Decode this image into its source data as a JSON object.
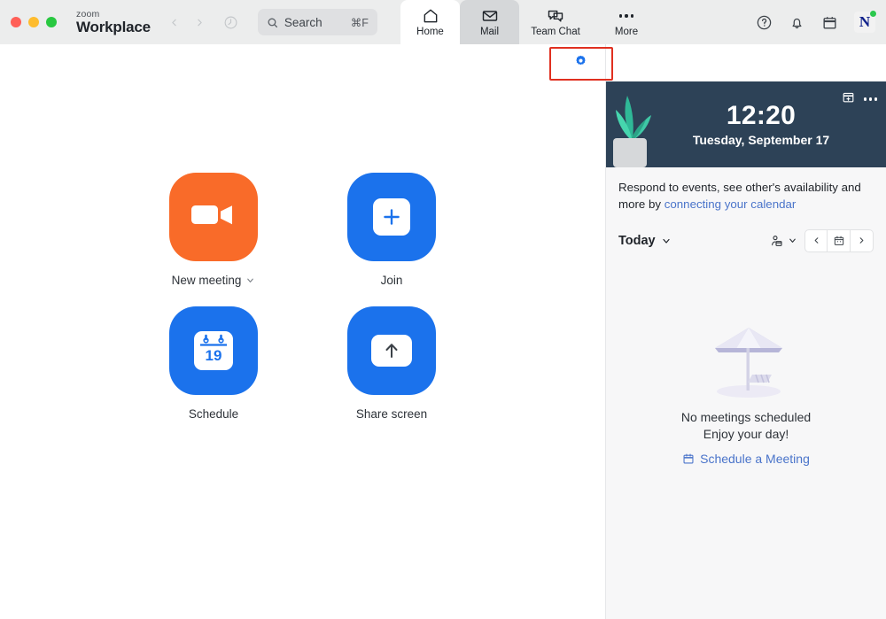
{
  "window": {
    "brand_small": "zoom",
    "brand_large": "Workplace",
    "traffic_lights": [
      "close-red",
      "minimize-yellow",
      "maximize-green"
    ],
    "colors": {
      "titlebar_bg": "#eceded",
      "accent_blue": "#1b72ec",
      "accent_orange": "#f96b29",
      "banner_bg": "#2d4257",
      "link_blue": "#4a74ca",
      "highlight_red": "#e03020",
      "status_green": "#2bc84d"
    }
  },
  "search": {
    "placeholder": "Search",
    "shortcut": "⌘F",
    "icon": "search-icon"
  },
  "nav": {
    "back_icon": "chevron-left-icon",
    "forward_icon": "chevron-right-icon",
    "history_icon": "history-circle-icon",
    "tabs": [
      {
        "label": "Home",
        "icon": "home-icon",
        "state": "active"
      },
      {
        "label": "Mail",
        "icon": "mail-envelope-icon",
        "state": "hover"
      },
      {
        "label": "Team Chat",
        "icon": "chat-bubbles-icon",
        "state": "default"
      },
      {
        "label": "More",
        "icon": "ellipsis-icon",
        "state": "default"
      }
    ],
    "right_icons": [
      {
        "name": "help-question-icon"
      },
      {
        "name": "notification-bell-icon"
      },
      {
        "name": "calendar-icon"
      }
    ],
    "avatar": {
      "initial": "N",
      "status": "online"
    }
  },
  "actions": [
    {
      "label": "New meeting",
      "icon": "video-camera-icon",
      "color": "orange",
      "has_chevron": true
    },
    {
      "label": "Join",
      "icon": "plus-icon",
      "color": "blue",
      "has_chevron": false
    },
    {
      "label": "Schedule",
      "icon": "calendar-19-icon",
      "color": "blue",
      "has_chevron": false,
      "day_number": "19"
    },
    {
      "label": "Share screen",
      "icon": "arrow-up-icon",
      "color": "blue",
      "has_chevron": false
    }
  ],
  "panel": {
    "settings_button": {
      "icon": "gear-icon",
      "highlighted": true
    },
    "banner": {
      "time": "12:20",
      "date": "Tuesday, September 17",
      "icons": [
        "calendar-add-icon",
        "ellipsis-icon"
      ],
      "decoration": "plant-illustration"
    },
    "connect_prompt": {
      "text_before": "Respond to events, see other's availability and more by ",
      "link_text": "connecting your calendar"
    },
    "controls": {
      "today_label": "Today",
      "today_chevron": "chevron-down-icon",
      "people_icon": "person-calendar-icon",
      "people_chevron": "chevron-down-icon",
      "prev": "‹",
      "calendar_icon": "calendar-icon",
      "next": "›"
    },
    "empty_state": {
      "illustration": "beach-umbrella-icon",
      "line1": "No meetings scheduled",
      "line2": "Enjoy your day!",
      "cta_label": "Schedule a Meeting",
      "cta_icon": "calendar-icon"
    }
  }
}
